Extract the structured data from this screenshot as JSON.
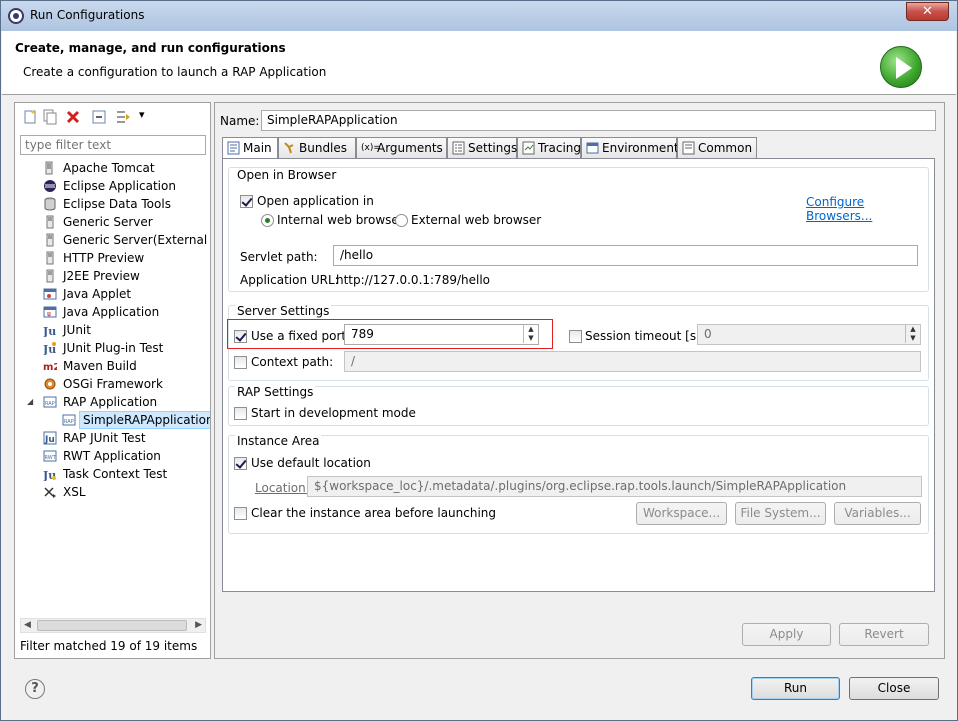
{
  "window": {
    "title": "Run Configurations",
    "close_glyph": "✕"
  },
  "header": {
    "title": "Create, manage, and run configurations",
    "subtitle": "Create a configuration to launch a RAP Application"
  },
  "left": {
    "filter_placeholder": "type filter text",
    "tree": [
      {
        "label": "Apache Tomcat",
        "icon": "tomcat-icon"
      },
      {
        "label": "Eclipse Application",
        "icon": "eclipse-icon"
      },
      {
        "label": "Eclipse Data Tools",
        "icon": "database-icon"
      },
      {
        "label": "Generic Server",
        "icon": "server-icon"
      },
      {
        "label": "Generic Server(External Lau",
        "icon": "server-icon"
      },
      {
        "label": "HTTP Preview",
        "icon": "server-icon"
      },
      {
        "label": "J2EE Preview",
        "icon": "server-icon"
      },
      {
        "label": "Java Applet",
        "icon": "applet-icon"
      },
      {
        "label": "Java Application",
        "icon": "java-app-icon"
      },
      {
        "label": "JUnit",
        "icon": "junit-icon"
      },
      {
        "label": "JUnit Plug-in Test",
        "icon": "junit-plugin-icon"
      },
      {
        "label": "Maven Build",
        "icon": "maven-icon"
      },
      {
        "label": "OSGi Framework",
        "icon": "osgi-icon"
      },
      {
        "label": "RAP Application",
        "icon": "rap-icon",
        "expanded": true
      },
      {
        "label": "SimpleRAPApplication",
        "icon": "rap-icon",
        "child": true,
        "selected": true
      },
      {
        "label": "RAP JUnit Test",
        "icon": "rap-junit-icon"
      },
      {
        "label": "RWT Application",
        "icon": "rwt-icon"
      },
      {
        "label": "Task Context Test",
        "icon": "task-context-icon"
      },
      {
        "label": "XSL",
        "icon": "xsl-icon"
      }
    ],
    "filter_status": "Filter matched 19 of 19 items"
  },
  "right": {
    "name_label": "Name:",
    "name_value": "SimpleRAPApplication",
    "tabs": [
      {
        "label": "Main",
        "icon": "main-tab-icon",
        "active": true
      },
      {
        "label": "Bundles",
        "icon": "bundles-icon"
      },
      {
        "label": "Arguments",
        "icon": "arguments-icon"
      },
      {
        "label": "Settings",
        "icon": "settings-icon"
      },
      {
        "label": "Tracing",
        "icon": "tracing-icon"
      },
      {
        "label": "Environment",
        "icon": "environment-icon"
      },
      {
        "label": "Common",
        "icon": "common-icon"
      }
    ],
    "browser": {
      "group_title": "Open in Browser",
      "open_label": "Open application in",
      "internal_label": "Internal web browser",
      "external_label": "External web browser",
      "configure_link": "Configure Browsers...",
      "servlet_label": "Servlet path:",
      "servlet_value": "/hello",
      "url_label": "Application URL:",
      "url_value": "http://127.0.0.1:789/hello"
    },
    "server": {
      "group_title": "Server Settings",
      "fixed_port_label": "Use a fixed port:",
      "fixed_port_value": "789",
      "timeout_label": "Session timeout [s]:",
      "timeout_value": "0",
      "context_label": "Context path:",
      "context_value": "/"
    },
    "rap": {
      "group_title": "RAP Settings",
      "dev_mode_label": "Start in development mode"
    },
    "instance": {
      "group_title": "Instance Area",
      "default_label": "Use default location",
      "location_label": "Location:",
      "location_value": "${workspace_loc}/.metadata/.plugins/org.eclipse.rap.tools.launch/SimpleRAPApplication",
      "clear_label": "Clear the instance area before launching",
      "workspace_btn": "Workspace...",
      "filesystem_btn": "File System...",
      "variables_btn": "Variables..."
    },
    "apply_btn": "Apply",
    "revert_btn": "Revert"
  },
  "footer": {
    "help_glyph": "?",
    "run_btn": "Run",
    "close_btn": "Close"
  },
  "glyphs": {
    "spin_up": "▲",
    "spin_down": "▼",
    "scroll_left": "◀",
    "scroll_right": "▶",
    "expanded": "◢",
    "dropdown": "▾"
  }
}
